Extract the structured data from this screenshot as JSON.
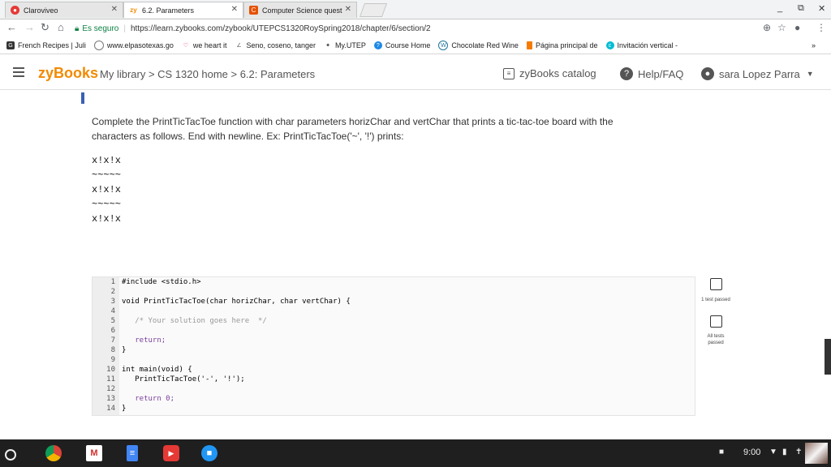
{
  "browser": {
    "tabs": [
      {
        "label": "Claroviveo",
        "active": false
      },
      {
        "label": "6.2. Parameters",
        "active": true
      },
      {
        "label": "Computer Science quest",
        "active": false
      }
    ],
    "controls": {
      "minimize": "_",
      "restore": "⧉",
      "close": "✕"
    },
    "address": {
      "secure_label": "Es seguro",
      "url": "https://learn.zybooks.com/zybook/UTEPCS1320RoySpring2018/chapter/6/section/2"
    },
    "bookmarks": [
      {
        "label": "French Recipes | Juli",
        "icon": "book-icon"
      },
      {
        "label": "www.elpasotexas.go",
        "icon": "globe-icon"
      },
      {
        "label": "we heart it",
        "icon": "heart-icon"
      },
      {
        "label": "Seno, coseno, tanger",
        "icon": "math-icon"
      },
      {
        "label": "My.UTEP",
        "icon": "utep-icon"
      },
      {
        "label": "Course Home",
        "icon": "help-icon"
      },
      {
        "label": "Chocolate Red Wine",
        "icon": "wordpress-icon"
      },
      {
        "label": "Página principal de",
        "icon": "page-icon"
      },
      {
        "label": "Invitación vertical -",
        "icon": "canva-icon"
      }
    ],
    "more": "»"
  },
  "header": {
    "logo": "zyBooks",
    "breadcrumb": "My library > CS 1320 home > 6.2: Parameters",
    "catalog": "zyBooks catalog",
    "help": "Help/FAQ",
    "user": "sara Lopez Parra"
  },
  "prompt": {
    "line1": "Complete the PrintTicTacToe function with char parameters horizChar and vertChar that prints a tic-tac-toe board with the",
    "line2": "characters as follows. End with newline. Ex: PrintTicTacToe('~', '!') prints:"
  },
  "sample_output": [
    "x!x!x",
    "~~~~~",
    "x!x!x",
    "~~~~~",
    "x!x!x"
  ],
  "code_lines": [
    {
      "n": "1",
      "text": "#include <stdio.h>"
    },
    {
      "n": "2",
      "text": ""
    },
    {
      "n": "3",
      "text": "void PrintTicTacToe(char horizChar, char vertChar) {"
    },
    {
      "n": "4",
      "text": ""
    },
    {
      "n": "5",
      "text": "   /* Your solution goes here  */"
    },
    {
      "n": "6",
      "text": ""
    },
    {
      "n": "7",
      "text": "   return;"
    },
    {
      "n": "8",
      "text": "}"
    },
    {
      "n": "9",
      "text": ""
    },
    {
      "n": "10",
      "text": "int main(void) {"
    },
    {
      "n": "11",
      "text": "   PrintTicTacToe('-', '!');"
    },
    {
      "n": "12",
      "text": ""
    },
    {
      "n": "13",
      "text": "   return 0;"
    },
    {
      "n": "14",
      "text": "}"
    }
  ],
  "results": {
    "test1": "1 test passed",
    "all": "All tests passed"
  },
  "taskbar": {
    "time": "9:00"
  },
  "colors": {
    "accent": "#f28a00",
    "link_blue": "#3b5fb5"
  }
}
